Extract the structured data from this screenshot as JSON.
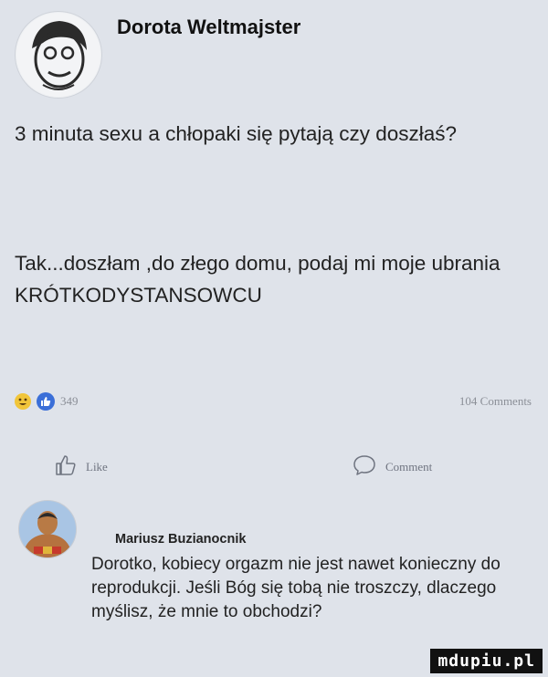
{
  "post": {
    "author": "Dorota Weltmajster",
    "paragraph1": "3 minuta sexu a chłopaki się pytają czy doszłaś?",
    "paragraph2": "Tak...doszłam ,do złego domu, podaj mi moje ubrania KRÓTKODYSTANSOWCU",
    "reaction_count": "349",
    "comments_count": "104 Comments"
  },
  "actions": {
    "like_label": "Like",
    "comment_label": "Comment"
  },
  "comment": {
    "author": "Mariusz Buzianocnik",
    "text": "Dorotko, kobiecy orgazm nie jest nawet konieczny do reprodukcji. Jeśli Bóg się tobą nie troszczy, dlaczego myślisz, że mnie to obchodzi?"
  },
  "watermark": "mdupiu.pl",
  "icons": [
    "emoji-laugh-icon",
    "like-reaction-icon",
    "thumbs-up-icon",
    "comment-bubble-icon"
  ]
}
